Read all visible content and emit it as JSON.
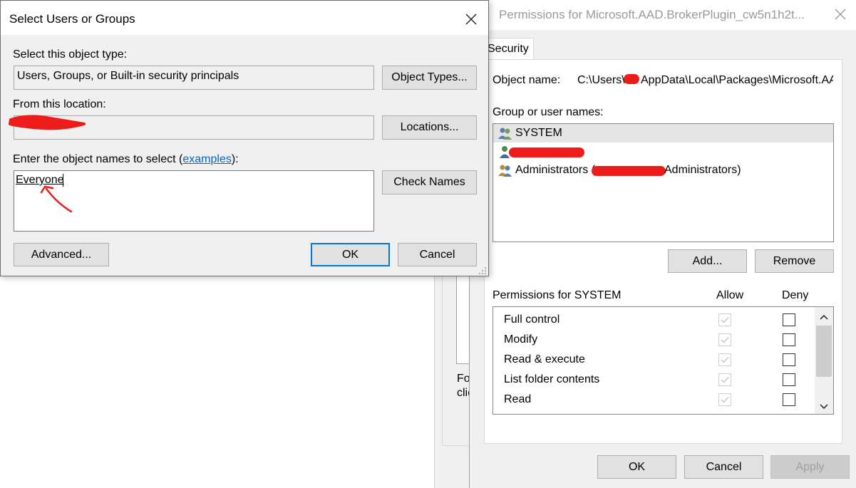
{
  "select_dialog": {
    "title": "Select Users or Groups",
    "object_type_label": "Select this object type:",
    "object_type_value": "Users, Groups, or Built-in security principals",
    "object_types_button": "Object Types...",
    "location_label": "From this location:",
    "locations_button": "Locations...",
    "names_label_prefix": "Enter the object names to select (",
    "names_label_link": "examples",
    "names_label_suffix": "):",
    "names_value": "Everyone",
    "check_names_button": "Check Names",
    "advanced_button": "Advanced...",
    "ok_button": "OK",
    "cancel_button": "Cancel"
  },
  "permissions_dialog": {
    "title": "Permissions for Microsoft.AAD.BrokerPlugin_cw5n1h2t...",
    "tab_security": "Security",
    "object_name_label": "Object name:",
    "object_name_prefix": "C:\\Users\\",
    "object_name_suffix": "AppData\\Local\\Packages\\Microsoft.AA",
    "group_names_label": "Group or user names:",
    "users": [
      {
        "name": "SYSTEM"
      },
      {
        "name": ""
      },
      {
        "name": "Administrators (",
        "suffix": "Administrators)"
      }
    ],
    "add_button": "Add...",
    "remove_button": "Remove",
    "permissions_for_label": "Permissions for SYSTEM",
    "allow_header": "Allow",
    "deny_header": "Deny",
    "permissions": [
      {
        "name": "Full control",
        "allow": true,
        "deny": false
      },
      {
        "name": "Modify",
        "allow": true,
        "deny": false
      },
      {
        "name": "Read & execute",
        "allow": true,
        "deny": false
      },
      {
        "name": "List folder contents",
        "allow": true,
        "deny": false
      },
      {
        "name": "Read",
        "allow": true,
        "deny": false
      }
    ],
    "ok_button": "OK",
    "cancel_button": "Cancel",
    "apply_button": "Apply"
  },
  "background_dialog": {
    "text_line1": "Fo",
    "text_line2": "clic"
  },
  "colors": {
    "annotation": "#ee1b1b",
    "accent": "#0078d7",
    "link": "#0066cc"
  }
}
